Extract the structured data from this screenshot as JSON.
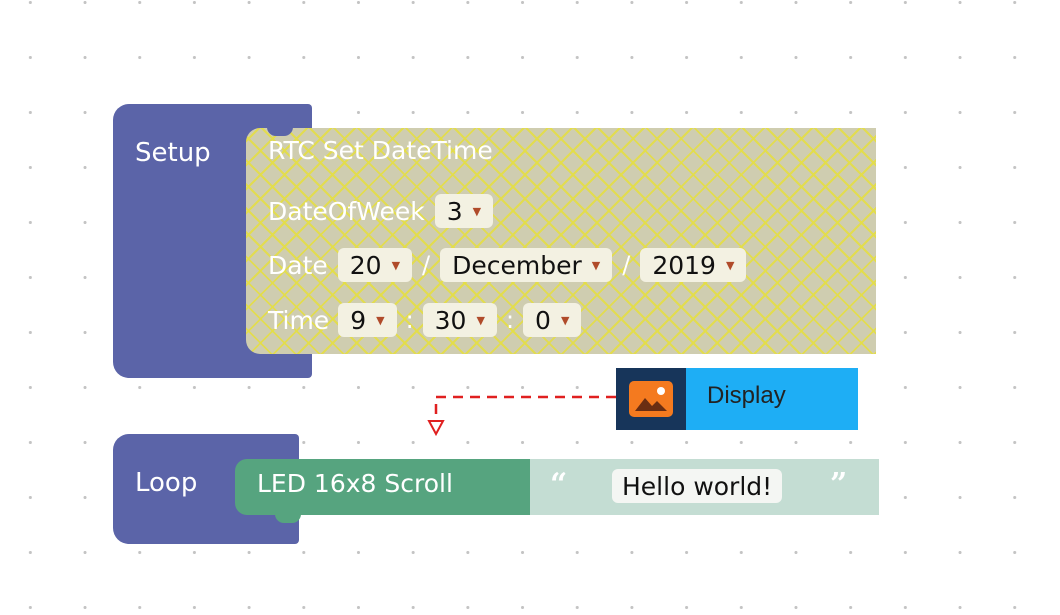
{
  "setup": {
    "label": "Setup",
    "rtc": {
      "title": "RTC Set DateTime",
      "day_of_week_label": "DateOfWeek",
      "day_of_week_value": "3",
      "date_label": "Date",
      "day": "20",
      "month": "December",
      "year": "2019",
      "date_separator": "/",
      "time_label": "Time",
      "hour": "9",
      "minute": "30",
      "second": "0",
      "time_separator": ":"
    }
  },
  "tooltip": {
    "label": "Display",
    "icon": "image-icon"
  },
  "loop": {
    "label": "Loop",
    "led": {
      "label": "LED 16x8 Scroll",
      "open_quote": "“",
      "close_quote": "”",
      "text": "Hello world!"
    }
  },
  "colors": {
    "hat_block": "#5b64a8",
    "led_block": "#56a47f",
    "text_block": "#c4ddd3",
    "tooltip_bg": "#1eaef5",
    "tooltip_icon_bg": "#17355a",
    "icon_orange": "#f47a1f",
    "dashed_line": "#e02020"
  },
  "dropdown_arrow": "▼"
}
